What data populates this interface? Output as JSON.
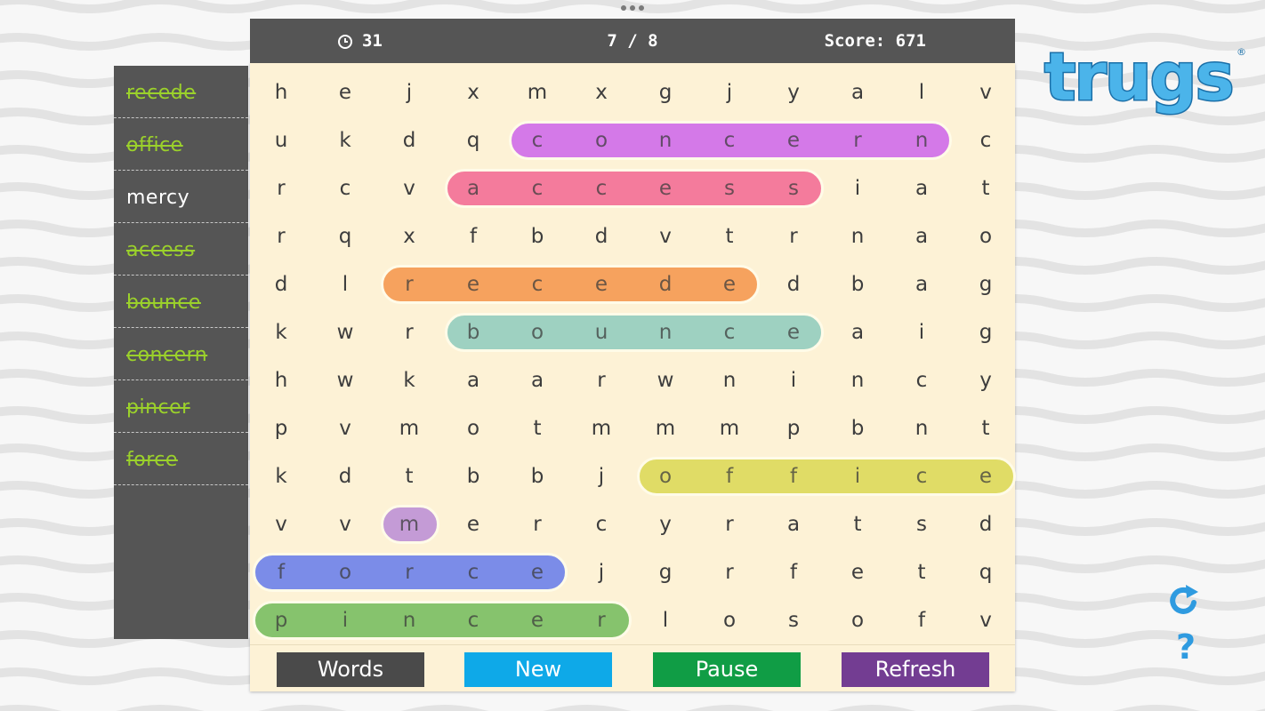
{
  "logo_text": "trugs",
  "timer": {
    "value": "31",
    "icon": "clock-icon"
  },
  "progress": {
    "text": "7 / 8"
  },
  "score": {
    "text": "Score: 671"
  },
  "word_list": [
    {
      "word": "recede",
      "found": true
    },
    {
      "word": "office",
      "found": true
    },
    {
      "word": "mercy",
      "found": false
    },
    {
      "word": "access",
      "found": true
    },
    {
      "word": "bounce",
      "found": true
    },
    {
      "word": "concern",
      "found": true
    },
    {
      "word": "pincer",
      "found": true
    },
    {
      "word": "force",
      "found": true
    }
  ],
  "grid": [
    [
      "h",
      "e",
      "j",
      "x",
      "m",
      "x",
      "g",
      "j",
      "y",
      "a",
      "l",
      "v"
    ],
    [
      "u",
      "k",
      "d",
      "q",
      "c",
      "o",
      "n",
      "c",
      "e",
      "r",
      "n",
      "c"
    ],
    [
      "r",
      "c",
      "v",
      "a",
      "c",
      "c",
      "e",
      "s",
      "s",
      "i",
      "a",
      "t"
    ],
    [
      "r",
      "q",
      "x",
      "f",
      "b",
      "d",
      "v",
      "t",
      "r",
      "n",
      "a",
      "o"
    ],
    [
      "d",
      "l",
      "r",
      "e",
      "c",
      "e",
      "d",
      "e",
      "d",
      "b",
      "a",
      "g"
    ],
    [
      "k",
      "w",
      "r",
      "b",
      "o",
      "u",
      "n",
      "c",
      "e",
      "a",
      "i",
      "g"
    ],
    [
      "h",
      "w",
      "k",
      "a",
      "a",
      "r",
      "w",
      "n",
      "i",
      "n",
      "c",
      "y"
    ],
    [
      "p",
      "v",
      "m",
      "o",
      "t",
      "m",
      "m",
      "m",
      "p",
      "b",
      "n",
      "t"
    ],
    [
      "k",
      "d",
      "t",
      "b",
      "b",
      "j",
      "o",
      "f",
      "f",
      "i",
      "c",
      "e"
    ],
    [
      "v",
      "v",
      "m",
      "e",
      "r",
      "c",
      "y",
      "r",
      "a",
      "t",
      "s",
      "d"
    ],
    [
      "f",
      "o",
      "r",
      "c",
      "e",
      "j",
      "g",
      "r",
      "f",
      "e",
      "t",
      "q"
    ],
    [
      "p",
      "i",
      "n",
      "c",
      "e",
      "r",
      "l",
      "o",
      "s",
      "o",
      "f",
      "v"
    ]
  ],
  "highlights": [
    {
      "word": "concern",
      "row": 1,
      "start": 4,
      "end": 10,
      "color": "#d479e8"
    },
    {
      "word": "access",
      "row": 2,
      "start": 3,
      "end": 8,
      "color": "#f47b9c"
    },
    {
      "word": "recede",
      "row": 4,
      "start": 2,
      "end": 7,
      "color": "#f6a25e"
    },
    {
      "word": "bounce",
      "row": 5,
      "start": 3,
      "end": 8,
      "color": "#9ed1c1"
    },
    {
      "word": "office",
      "row": 8,
      "start": 6,
      "end": 11,
      "color": "#e0dc66"
    },
    {
      "word": "m",
      "row": 9,
      "start": 2,
      "end": 2,
      "color": "#c49bd6"
    },
    {
      "word": "force",
      "row": 10,
      "start": 0,
      "end": 4,
      "color": "#7b8ce8"
    },
    {
      "word": "pincer",
      "row": 11,
      "start": 0,
      "end": 5,
      "color": "#86c36d"
    }
  ],
  "buttons": [
    {
      "label": "Words",
      "color": "#4a4a4a"
    },
    {
      "label": "New",
      "color": "#0ea9e8"
    },
    {
      "label": "Pause",
      "color": "#109d45"
    },
    {
      "label": "Refresh",
      "color": "#733d92"
    }
  ],
  "side_icons": [
    {
      "icon": "refresh-icon",
      "color": "#2f9be0"
    },
    {
      "icon": "help-icon",
      "color": "#2f9be0"
    }
  ]
}
